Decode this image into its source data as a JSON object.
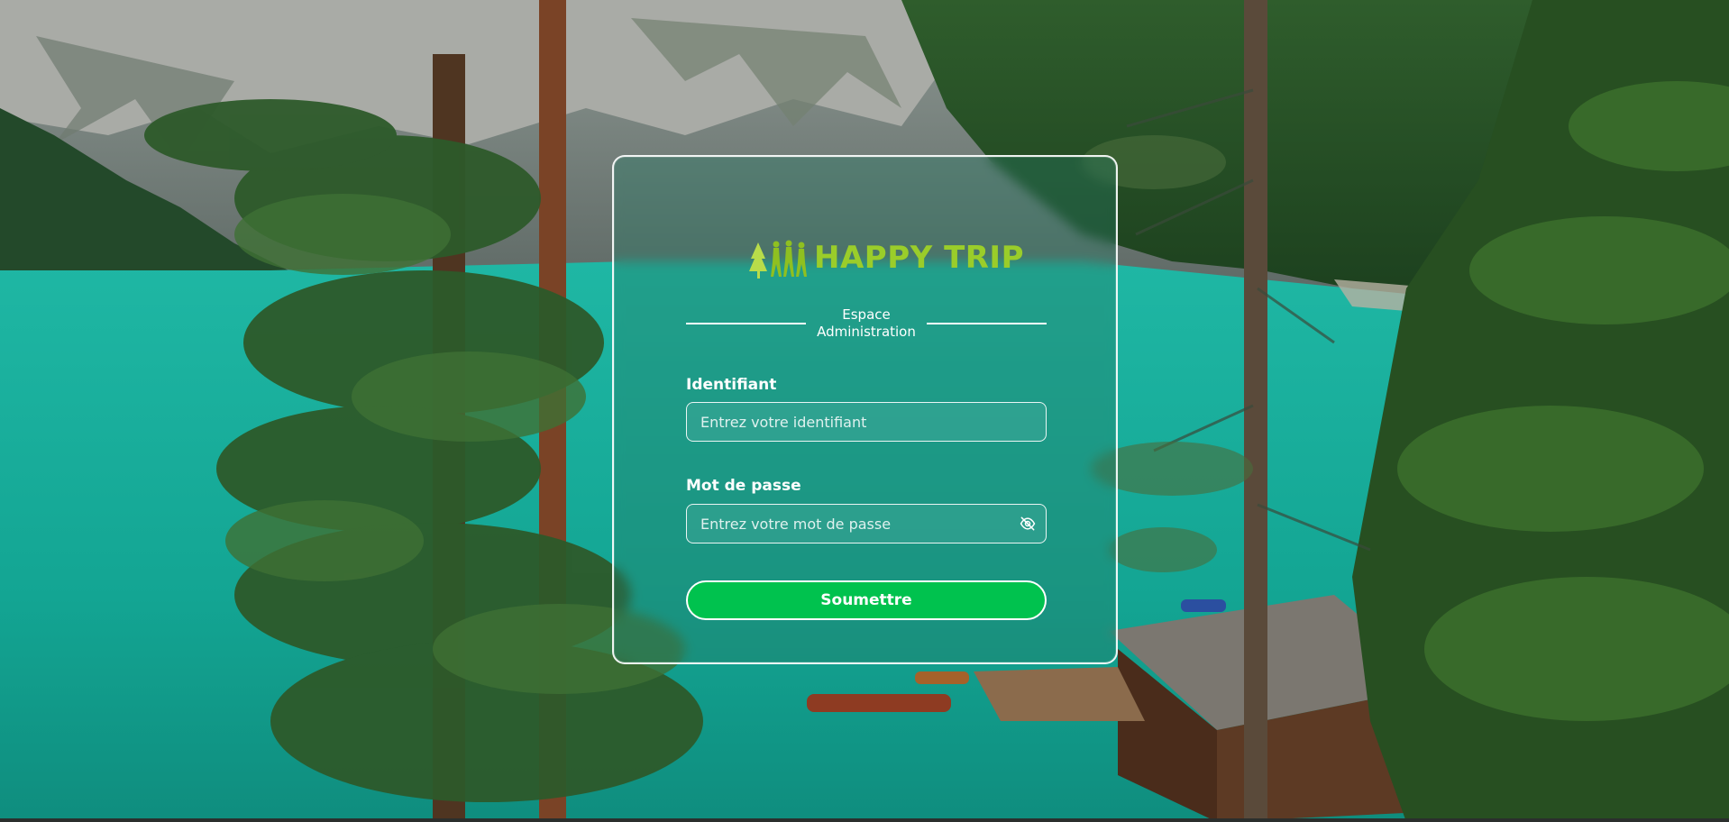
{
  "brand": {
    "name": "HAPPY TRIP",
    "color": "#9acd2a"
  },
  "section_title": "Espace Administration",
  "form": {
    "username": {
      "label": "Identifiant",
      "placeholder": "Entrez votre identifiant",
      "value": ""
    },
    "password": {
      "label": "Mot de passe",
      "placeholder": "Entrez votre mot de passe",
      "value": "",
      "toggle_icon": "eye-off-icon"
    },
    "submit_label": "Soumettre"
  },
  "colors": {
    "submit_button": "#00c24e",
    "lake": "#17b3a0",
    "forest": "#1f4a24"
  }
}
